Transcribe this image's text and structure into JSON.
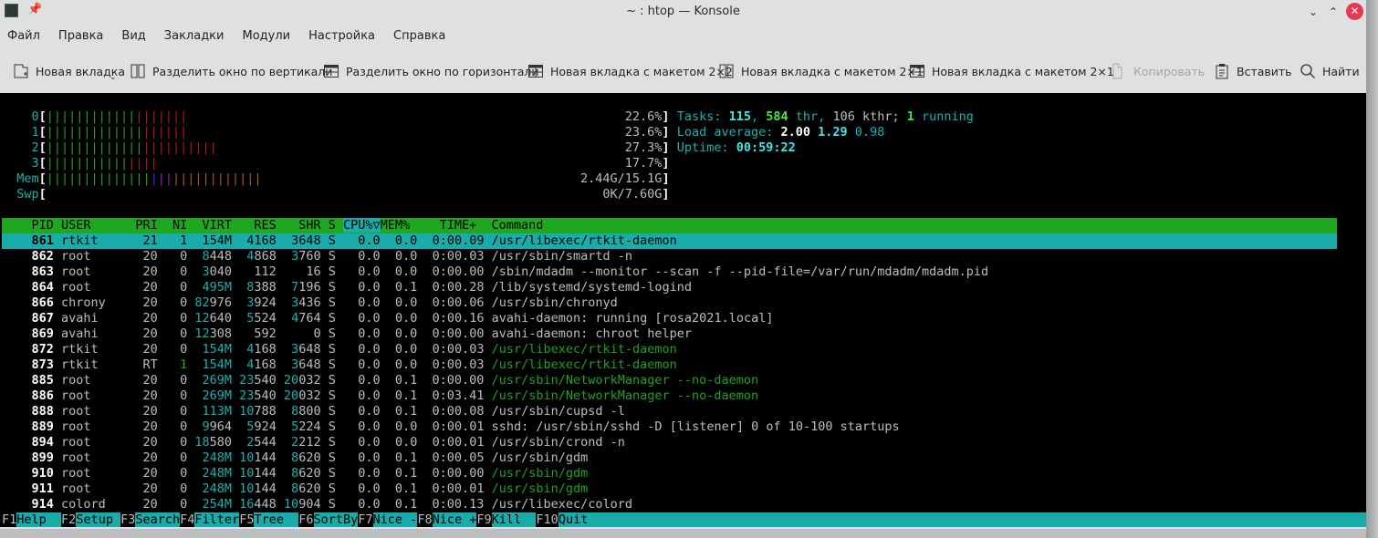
{
  "window": {
    "title": "~ : htop — Konsole",
    "minimize": "⌄",
    "maximize": "⌃",
    "close": "✕"
  },
  "menu": [
    "Файл",
    "Правка",
    "Вид",
    "Закладки",
    "Модули",
    "Настройка",
    "Справка"
  ],
  "toolbar": [
    {
      "label": "Новая вкладка",
      "icon": "new-tab-icon",
      "dropdown": true
    },
    {
      "label": "Разделить окно по вертикали",
      "icon": "split-vertical-icon"
    },
    {
      "label": "Разделить окно по горизонтали",
      "icon": "split-horizontal-icon"
    },
    {
      "label": "Новая вкладка с макетом 2×2",
      "icon": "layout-2x2-icon"
    },
    {
      "label": "Новая вкладка с макетом 2×1",
      "icon": "layout-2x1-vertical-icon"
    },
    {
      "label": "Новая вкладка с макетом 2×1",
      "icon": "layout-2x1-horizontal-icon"
    },
    {
      "label": "Копировать",
      "icon": "copy-icon",
      "disabled": true
    },
    {
      "label": "Вставить",
      "icon": "paste-icon"
    },
    {
      "label": "Найти",
      "icon": "search-icon"
    }
  ],
  "meters": {
    "cpus": [
      {
        "label": "0",
        "user_pct": 14.5,
        "system_pct": 8.1,
        "text": "22.6%"
      },
      {
        "label": "1",
        "user_pct": 16.0,
        "system_pct": 7.6,
        "text": "23.6%"
      },
      {
        "label": "2",
        "user_pct": 15.5,
        "system_pct": 11.8,
        "text": "27.3%"
      },
      {
        "label": "3",
        "user_pct": 13.0,
        "system_pct": 4.7,
        "text": "17.7%"
      }
    ],
    "mem": {
      "label": "Mem",
      "used": 0.169,
      "buffers": 0.012,
      "shared": 0.024,
      "cache": 0.145,
      "text": "2.44G/15.1G"
    },
    "swp": {
      "label": "Swp",
      "used": 0,
      "text": "0K/7.60G"
    },
    "tasks": {
      "label": "Tasks: ",
      "count": "115",
      "threads": "584",
      "thr": " thr, ",
      "kthr": "106 kthr; ",
      "running": "1",
      "running_label": " running"
    },
    "load": {
      "label": "Load average: ",
      "l1": "2.00",
      "l5": "1.29",
      "l15": "0.98"
    },
    "uptime": {
      "label": "Uptime: ",
      "value": "00:59:22"
    }
  },
  "columns": [
    "PID",
    "USER",
    "PRI",
    "NI",
    "VIRT",
    "RES",
    "SHR",
    "S",
    "CPU%▽",
    "MEM%",
    "TIME+",
    "Command"
  ],
  "processes": [
    {
      "pid": "861",
      "user": "rtkit",
      "pri": "21",
      "ni": "1",
      "virt": "154M",
      "res": "4168",
      "shr": "3648",
      "s": "S",
      "cpu": "0.0",
      "mem": "0.0",
      "time": "0:00.09",
      "cmd": "/usr/libexec/rtkit-daemon",
      "selected": true
    },
    {
      "pid": "862",
      "user": "root",
      "pri": "20",
      "ni": "0",
      "virt": "8448",
      "res": "4868",
      "shr": "3760",
      "s": "S",
      "cpu": "0.0",
      "mem": "0.0",
      "time": "0:00.03",
      "cmd": "/usr/sbin/smartd -n"
    },
    {
      "pid": "863",
      "user": "root",
      "pri": "20",
      "ni": "0",
      "virt": "3040",
      "res": "112",
      "shr": "16",
      "s": "S",
      "cpu": "0.0",
      "mem": "0.0",
      "time": "0:00.00",
      "cmd": "/sbin/mdadm --monitor --scan -f --pid-file=/var/run/mdadm/mdadm.pid"
    },
    {
      "pid": "864",
      "user": "root",
      "pri": "20",
      "ni": "0",
      "virt": "495M",
      "res": "8388",
      "shr": "7196",
      "s": "S",
      "cpu": "0.0",
      "mem": "0.1",
      "time": "0:00.28",
      "cmd": "/lib/systemd/systemd-logind"
    },
    {
      "pid": "866",
      "user": "chrony",
      "pri": "20",
      "ni": "0",
      "virt": "82976",
      "res": "3924",
      "shr": "3436",
      "s": "S",
      "cpu": "0.0",
      "mem": "0.0",
      "time": "0:00.06",
      "cmd": "/usr/sbin/chronyd"
    },
    {
      "pid": "867",
      "user": "avahi",
      "pri": "20",
      "ni": "0",
      "virt": "12640",
      "res": "5524",
      "shr": "4764",
      "s": "S",
      "cpu": "0.0",
      "mem": "0.0",
      "time": "0:00.16",
      "cmd": "avahi-daemon: running [rosa2021.local]"
    },
    {
      "pid": "869",
      "user": "avahi",
      "pri": "20",
      "ni": "0",
      "virt": "12308",
      "res": "592",
      "shr": "0",
      "s": "S",
      "cpu": "0.0",
      "mem": "0.0",
      "time": "0:00.00",
      "cmd": "avahi-daemon: chroot helper"
    },
    {
      "pid": "872",
      "user": "rtkit",
      "pri": "20",
      "ni": "0",
      "virt": "154M",
      "res": "4168",
      "shr": "3648",
      "s": "S",
      "cpu": "0.0",
      "mem": "0.0",
      "time": "0:00.03",
      "cmd": "/usr/libexec/rtkit-daemon",
      "thread": true
    },
    {
      "pid": "873",
      "user": "rtkit",
      "pri": "RT",
      "ni": "1",
      "virt": "154M",
      "res": "4168",
      "shr": "3648",
      "s": "S",
      "cpu": "0.0",
      "mem": "0.0",
      "time": "0:00.03",
      "cmd": "/usr/libexec/rtkit-daemon",
      "thread": true,
      "ni_green": true
    },
    {
      "pid": "885",
      "user": "root",
      "pri": "20",
      "ni": "0",
      "virt": "269M",
      "res": "23540",
      "shr": "20032",
      "s": "S",
      "cpu": "0.0",
      "mem": "0.1",
      "time": "0:00.00",
      "cmd": "/usr/sbin/NetworkManager --no-daemon",
      "thread": true
    },
    {
      "pid": "886",
      "user": "root",
      "pri": "20",
      "ni": "0",
      "virt": "269M",
      "res": "23540",
      "shr": "20032",
      "s": "S",
      "cpu": "0.0",
      "mem": "0.1",
      "time": "0:03.41",
      "cmd": "/usr/sbin/NetworkManager --no-daemon",
      "thread": true
    },
    {
      "pid": "888",
      "user": "root",
      "pri": "20",
      "ni": "0",
      "virt": "113M",
      "res": "10788",
      "shr": "8800",
      "s": "S",
      "cpu": "0.0",
      "mem": "0.1",
      "time": "0:00.08",
      "cmd": "/usr/sbin/cupsd -l"
    },
    {
      "pid": "889",
      "user": "root",
      "pri": "20",
      "ni": "0",
      "virt": "9964",
      "res": "5924",
      "shr": "5224",
      "s": "S",
      "cpu": "0.0",
      "mem": "0.0",
      "time": "0:00.01",
      "cmd": "sshd: /usr/sbin/sshd -D [listener] 0 of 10-100 startups"
    },
    {
      "pid": "894",
      "user": "root",
      "pri": "20",
      "ni": "0",
      "virt": "18580",
      "res": "2544",
      "shr": "2212",
      "s": "S",
      "cpu": "0.0",
      "mem": "0.0",
      "time": "0:00.01",
      "cmd": "/usr/sbin/crond -n"
    },
    {
      "pid": "899",
      "user": "root",
      "pri": "20",
      "ni": "0",
      "virt": "248M",
      "res": "10144",
      "shr": "8620",
      "s": "S",
      "cpu": "0.0",
      "mem": "0.1",
      "time": "0:00.05",
      "cmd": "/usr/sbin/gdm"
    },
    {
      "pid": "910",
      "user": "root",
      "pri": "20",
      "ni": "0",
      "virt": "248M",
      "res": "10144",
      "shr": "8620",
      "s": "S",
      "cpu": "0.0",
      "mem": "0.1",
      "time": "0:00.00",
      "cmd": "/usr/sbin/gdm",
      "thread": true
    },
    {
      "pid": "911",
      "user": "root",
      "pri": "20",
      "ni": "0",
      "virt": "248M",
      "res": "10144",
      "shr": "8620",
      "s": "S",
      "cpu": "0.0",
      "mem": "0.1",
      "time": "0:00.01",
      "cmd": "/usr/sbin/gdm",
      "thread": true
    },
    {
      "pid": "914",
      "user": "colord",
      "pri": "20",
      "ni": "0",
      "virt": "254M",
      "res": "16448",
      "shr": "10904",
      "s": "S",
      "cpu": "0.0",
      "mem": "0.1",
      "time": "0:00.13",
      "cmd": "/usr/libexec/colord"
    }
  ],
  "footer": [
    {
      "key": "F1",
      "label": "Help  "
    },
    {
      "key": "F2",
      "label": "Setup "
    },
    {
      "key": "F3",
      "label": "Search"
    },
    {
      "key": "F4",
      "label": "Filter"
    },
    {
      "key": "F5",
      "label": "Tree  "
    },
    {
      "key": "F6",
      "label": "SortBy"
    },
    {
      "key": "F7",
      "label": "Nice -"
    },
    {
      "key": "F8",
      "label": "Nice +"
    },
    {
      "key": "F9",
      "label": "Kill  "
    },
    {
      "key": "F10",
      "label": "Quit"
    }
  ]
}
